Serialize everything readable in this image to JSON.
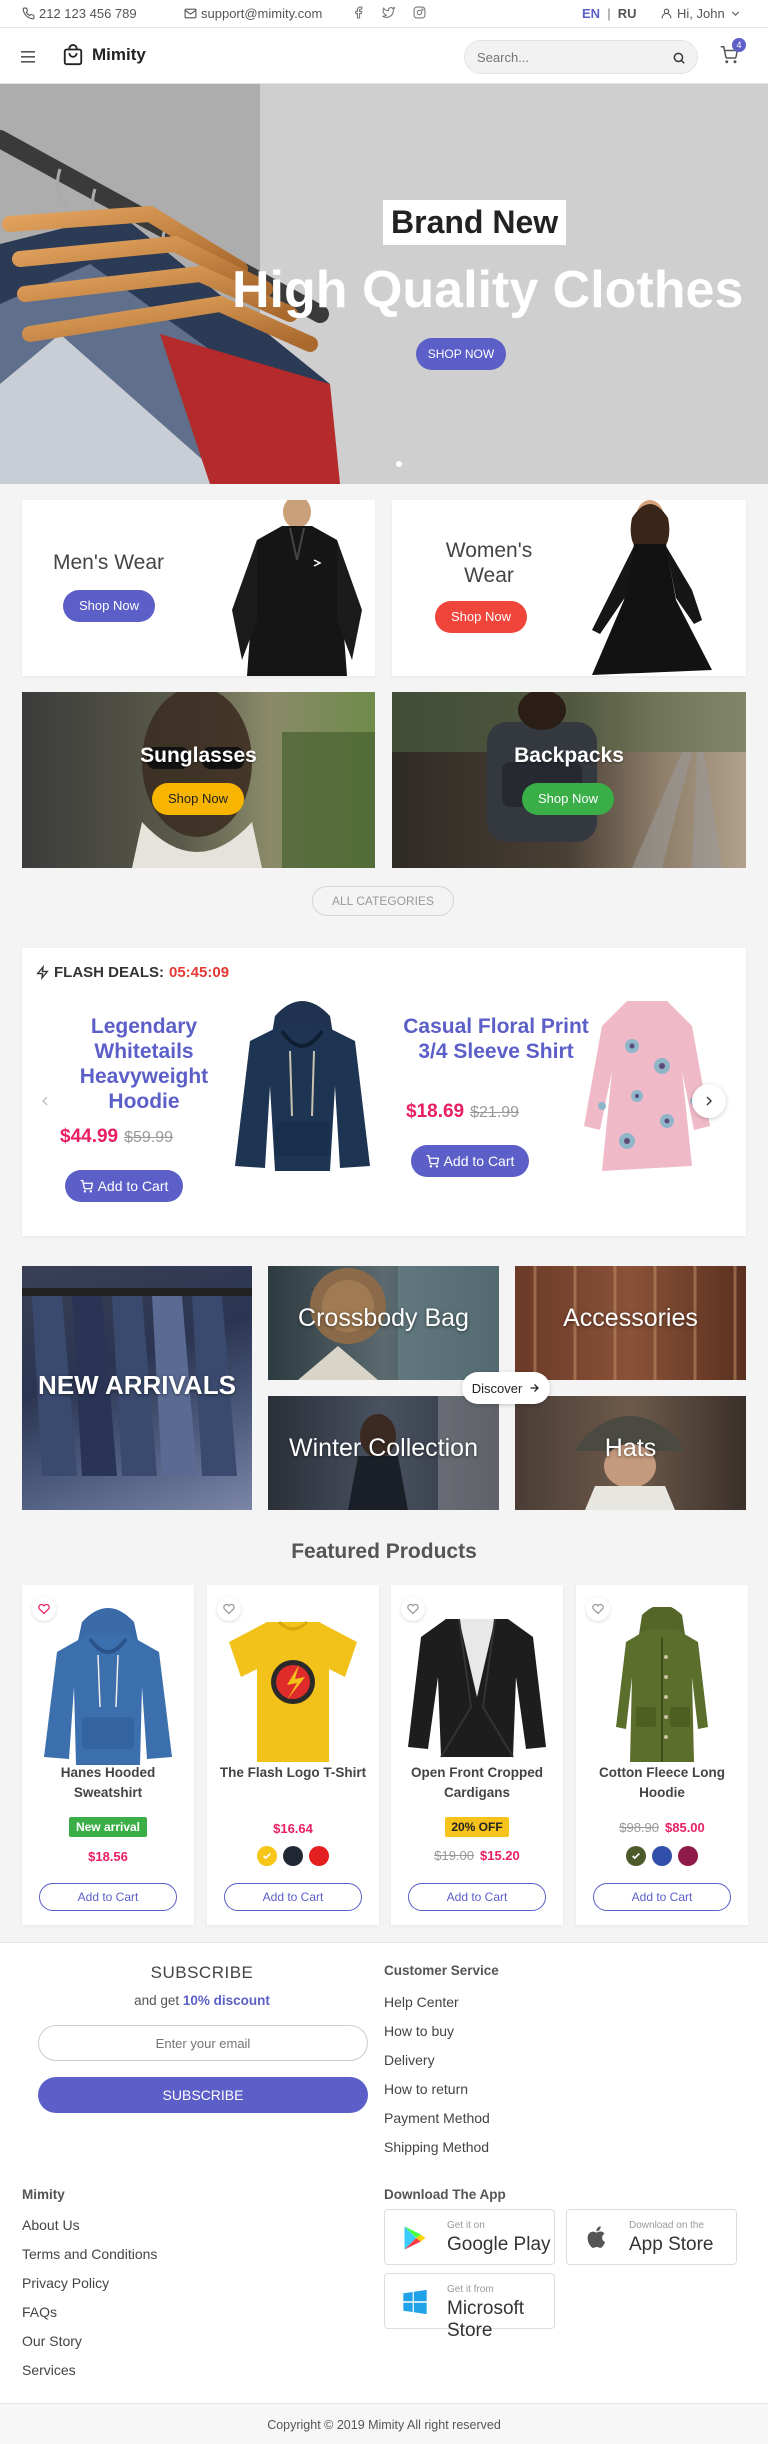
{
  "topbar": {
    "phone": "212 123 456 789",
    "email": "support@mimity.com",
    "lang_en": "EN",
    "lang_sep": "|",
    "lang_ru": "RU",
    "user": "Hi, John"
  },
  "header": {
    "brand": "Mimity",
    "search_placeholder": "Search...",
    "cart_count": "4"
  },
  "hero": {
    "tag": "Brand New",
    "title": "High Quality Clothes",
    "cta": "SHOP NOW"
  },
  "categories": {
    "mens": {
      "title": "Men's Wear",
      "cta": "Shop Now"
    },
    "womens": {
      "title": "Women's Wear",
      "cta": "Shop Now"
    },
    "sunglasses": {
      "title": "Sunglasses",
      "cta": "Shop Now"
    },
    "backpacks": {
      "title": "Backpacks",
      "cta": "Shop Now"
    },
    "all": "ALL CATEGORIES"
  },
  "flash": {
    "label": "FLASH DEALS:",
    "timer": "05:45:09",
    "items": [
      {
        "name": "Legendary Whitetails Heavyweight Hoodie",
        "price": "$44.99",
        "old": "$59.99",
        "cta": "Add to Cart"
      },
      {
        "name": "Casual Floral Print 3/4 Sleeve Shirt",
        "price": "$18.69",
        "old": "$21.99",
        "cta": "Add to Cart"
      }
    ]
  },
  "tiles": {
    "new_arrivals": "NEW ARRIVALS",
    "crossbody": "Crossbody Bag",
    "accessories": "Accessories",
    "winter": "Winter Collection",
    "hats": "Hats",
    "discover": "Discover"
  },
  "featured": {
    "title": "Featured Products",
    "products": [
      {
        "name": "Hanes Hooded Sweatshirt",
        "badge": "New arrival",
        "price": "$18.56",
        "cta": "Add to Cart"
      },
      {
        "name": "The Flash Logo T-Shirt",
        "price": "$16.64",
        "colors": [
          "#f5c518",
          "#222833",
          "#e41f1f"
        ],
        "cta": "Add to Cart"
      },
      {
        "name": "Open Front Cropped Cardigans",
        "badge": "20% OFF",
        "old": "$19.00",
        "price": "$15.20",
        "cta": "Add to Cart"
      },
      {
        "name": "Cotton Fleece Long Hoodie",
        "old": "$98.90",
        "price": "$85.00",
        "colors": [
          "#4d5a2a",
          "#2f4fa8",
          "#8e1b4a"
        ],
        "cta": "Add to Cart"
      }
    ]
  },
  "footer": {
    "subscribe_title": "SUBSCRIBE",
    "subscribe_text_pre": "and get",
    "subscribe_discount": "10% discount",
    "email_placeholder": "Enter your email",
    "subscribe_btn": "SUBSCRIBE",
    "cs_title": "Customer Service",
    "cs_links": [
      "Help Center",
      "How to buy",
      "Delivery",
      "How to return",
      "Payment Method",
      "Shipping Method"
    ],
    "brand_title": "Mimity",
    "brand_links": [
      "About Us",
      "Terms and Conditions",
      "Privacy Policy",
      "FAQs",
      "Our Story",
      "Services"
    ],
    "app_title": "Download The App",
    "stores": [
      {
        "small": "Get it on",
        "big": "Google Play"
      },
      {
        "small": "Download on the",
        "big": "App Store"
      },
      {
        "small": "Get it from",
        "big": "Microsoft Store"
      }
    ],
    "copyright": "Copyright © 2019 Mimity All right reserved"
  },
  "colors": {
    "accent": "#5b5fc7",
    "danger": "#f0453a",
    "warning": "#f7b500",
    "success": "#3aaf47",
    "pink": "#e91e63"
  }
}
